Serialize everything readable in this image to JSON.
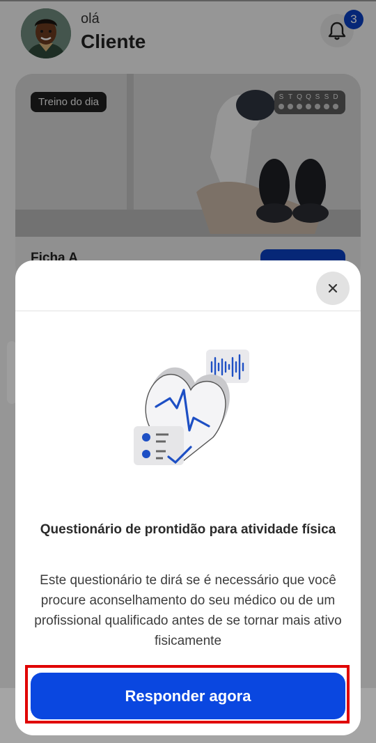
{
  "header": {
    "greeting": "olá",
    "user_name": "Cliente",
    "notification_count": "3"
  },
  "workout_card": {
    "tag": "Treino do dia",
    "week_days": [
      "S",
      "T",
      "Q",
      "Q",
      "S",
      "S",
      "D"
    ],
    "sheet_title": "Ficha A"
  },
  "modal": {
    "close_icon": "close-icon",
    "title": "Questionário de prontidão para atividade física",
    "description": "Este questionário te dirá se é necessário que você procure aconselhamento do seu médico ou de um profissional qualificado antes de se tornar mais ativo fisicamente",
    "cta_label": "Responder agora"
  },
  "colors": {
    "primary": "#0a47e0",
    "badge": "#0a3fc0",
    "highlight": "#e00000"
  }
}
